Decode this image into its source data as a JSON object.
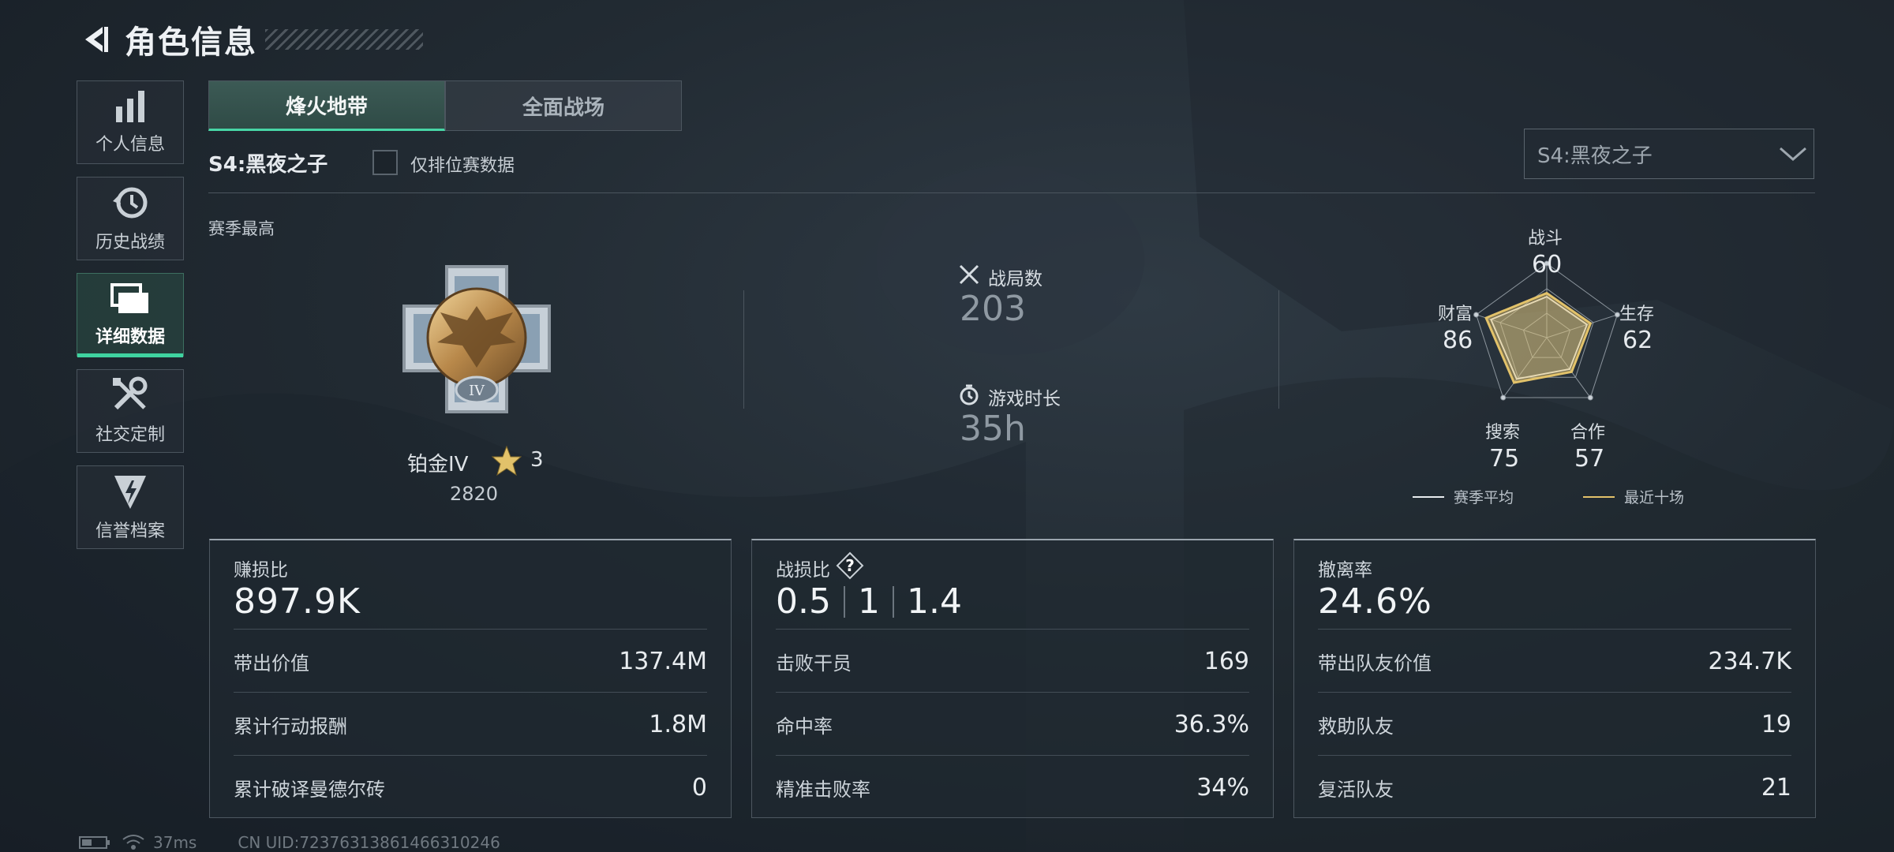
{
  "header": {
    "title": "角色信息"
  },
  "sidebar": {
    "items": [
      {
        "label": "个人信息",
        "icon": "bar-chart-icon"
      },
      {
        "label": "历史战绩",
        "icon": "clock-history-icon"
      },
      {
        "label": "详细数据",
        "icon": "folder-icon",
        "active": true
      },
      {
        "label": "社交定制",
        "icon": "tools-icon"
      },
      {
        "label": "信誉档案",
        "icon": "emblem-icon"
      }
    ]
  },
  "tabs": [
    {
      "label": "烽火地带",
      "active": true
    },
    {
      "label": "全面战场",
      "active": false
    }
  ],
  "season": {
    "label": "S4:黑夜之子",
    "ranked_only_label": "仅排位赛数据",
    "ranked_only_checked": false,
    "select_value": "S4:黑夜之子"
  },
  "season_best": {
    "heading": "赛季最高",
    "rank_name": "铂金IV",
    "stars": "3",
    "score": "2820",
    "badge_numeral": "IV"
  },
  "match_stats": {
    "matches_label": "战局数",
    "matches_value": "203",
    "playtime_label": "游戏时长",
    "playtime_value": "35h"
  },
  "radar": {
    "axes": [
      {
        "label": "战斗",
        "value": "60"
      },
      {
        "label": "生存",
        "value": "62"
      },
      {
        "label": "合作",
        "value": "57"
      },
      {
        "label": "搜索",
        "value": "75"
      },
      {
        "label": "财富",
        "value": "86"
      }
    ],
    "legend": [
      {
        "label": "赛季平均",
        "color": "#e8ecef"
      },
      {
        "label": "最近十场",
        "color": "#e2c26a"
      }
    ]
  },
  "cards": {
    "profit": {
      "title": "赚损比",
      "big": "897.9K",
      "rows": [
        {
          "k": "带出价值",
          "v": "137.4M"
        },
        {
          "k": "累计行动报酬",
          "v": "1.8M"
        },
        {
          "k": "累计破译曼德尔砖",
          "v": "0"
        }
      ]
    },
    "kd": {
      "title": "战损比",
      "ratio": [
        "0.5",
        "1",
        "1.4"
      ],
      "rows": [
        {
          "k": "击败干员",
          "v": "169"
        },
        {
          "k": "命中率",
          "v": "36.3%"
        },
        {
          "k": "精准击败率",
          "v": "34%"
        }
      ]
    },
    "extract": {
      "title": "撤离率",
      "big": "24.6%",
      "rows": [
        {
          "k": "带出队友价值",
          "v": "234.7K"
        },
        {
          "k": "救助队友",
          "v": "19"
        },
        {
          "k": "复活队友",
          "v": "21"
        }
      ]
    }
  },
  "status": {
    "ping": "37ms",
    "uid": "CN UID:72376313861466310246"
  },
  "colors": {
    "accent": "#3fd3a0",
    "gold": "#e2c26a"
  }
}
